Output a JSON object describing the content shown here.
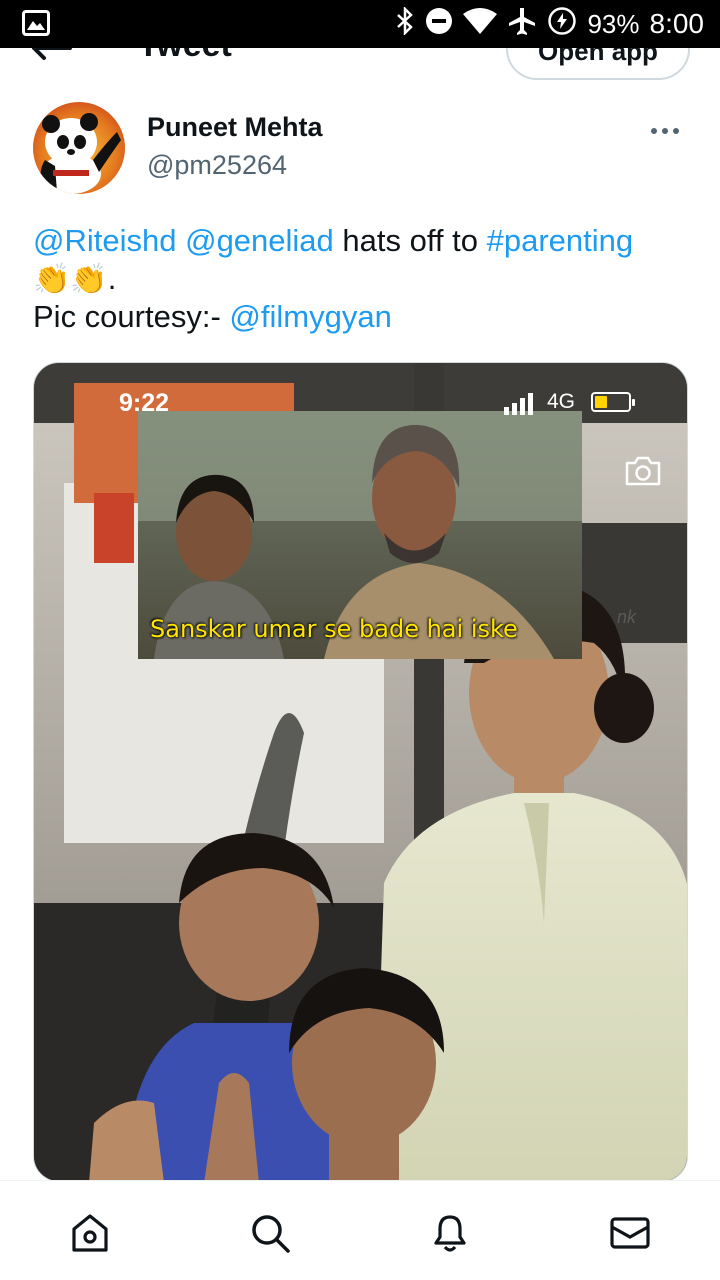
{
  "status_bar": {
    "battery": "93%",
    "time": "8:00",
    "icons": [
      "image-icon",
      "bluetooth-icon",
      "do-not-disturb-icon",
      "wifi-icon",
      "airplane-icon",
      "battery-saver-icon"
    ]
  },
  "header": {
    "title": "Tweet",
    "open_app_label": "Open app",
    "back_icon": "back-arrow-icon"
  },
  "tweet": {
    "author_name": "Puneet Mehta",
    "author_handle": "@pm25264",
    "more_icon": "more-icon",
    "text": {
      "mention_1": "@Riteishd",
      "mention_2": "@geneliad",
      "phrase": "hats off to",
      "hashtag": "#parenting",
      "emoji": "👏👏",
      "period": ".",
      "courtesy_prefix": "Pic courtesy:-",
      "mention_3": "@filmygyan"
    }
  },
  "media": {
    "phone_time": "9:22",
    "phone_network": "4G",
    "meme_caption": "Sanskar umar se bade hai iske",
    "background_sign": "nk",
    "camera_icon": "camera-icon"
  },
  "bottom_nav": {
    "items": [
      "home-icon",
      "search-icon",
      "notifications-icon",
      "messages-icon"
    ]
  },
  "colors": {
    "link": "#1d9bf0",
    "secondary_text": "#536471",
    "caption_yellow": "#ffe500"
  }
}
